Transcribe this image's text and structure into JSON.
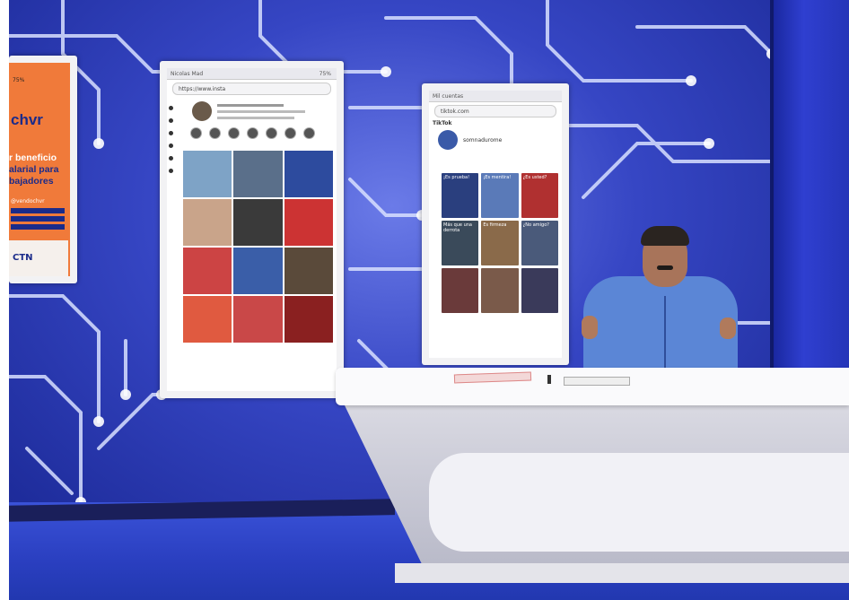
{
  "left_screen": {
    "zoom": "75%",
    "title": "chvr",
    "line1": "r beneficio",
    "line2": "alarial para",
    "line3": "bajadores",
    "handle": "@vendochvr",
    "logo": "CTN"
  },
  "mid_screen": {
    "url": "https://www.insta",
    "tab": "Nicolas Mad",
    "zoom": "75%"
  },
  "right_screen": {
    "tab": "Mil cuentas",
    "url": "tiktok.com",
    "brand": "TikTok",
    "username": "somnadurome",
    "tiles": [
      "¡Es prueba!",
      "¡Es mentira!",
      "¿Es usted?",
      "Más que una derrota",
      "Es firmeza",
      "¿No amigo?"
    ]
  },
  "colors": {
    "wall": "#3646c4",
    "trace": "#d8e0ff",
    "jacket": "#5b86d6",
    "orange": "#f07a3a"
  }
}
